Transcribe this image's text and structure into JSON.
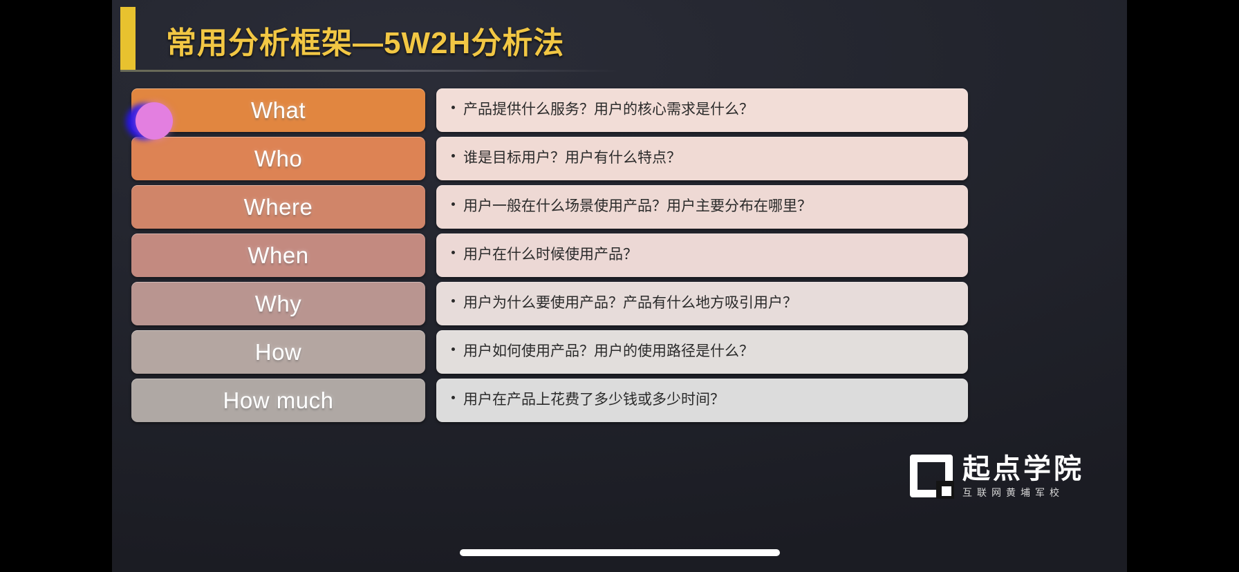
{
  "slide": {
    "title": "常用分析框架—5W2H分析法",
    "accent_color": "#f2c744",
    "background_color": "#23252e",
    "rows": [
      {
        "key": "What",
        "description": "产品提供什么服务？用户的核心需求是什么？",
        "key_color": "#e18640",
        "desc_color": "#f2ddd7"
      },
      {
        "key": "Who",
        "description": "谁是目标用户？用户有什么特点？",
        "key_color": "#dd8354",
        "desc_color": "#f0dad4"
      },
      {
        "key": "Where",
        "description": "用户一般在什么场景使用产品？用户主要分布在哪里？",
        "key_color": "#d08569",
        "desc_color": "#eed9d4"
      },
      {
        "key": "When",
        "description": "用户在什么时候使用产品？",
        "key_color": "#c38a80",
        "desc_color": "#ecd8d5"
      },
      {
        "key": "Why",
        "description": "用户为什么要使用产品？产品有什么地方吸引用户？",
        "key_color": "#b99590",
        "desc_color": "#e7dcda"
      },
      {
        "key": "How",
        "description": "用户如何使用产品？用户的使用路径是什么？",
        "key_color": "#b4a6a1",
        "desc_color": "#e2dedc"
      },
      {
        "key": "How much",
        "description": "用户在产品上花费了多少钱或多少时间？",
        "key_color": "#afa8a4",
        "desc_color": "#dcdcdc"
      }
    ]
  },
  "logo": {
    "name": "起点学院",
    "subtitle": "互联网黄埔军校"
  },
  "overlay": {
    "touch_color": "#e37fe0",
    "touch_glow_color": "#2717e0"
  }
}
